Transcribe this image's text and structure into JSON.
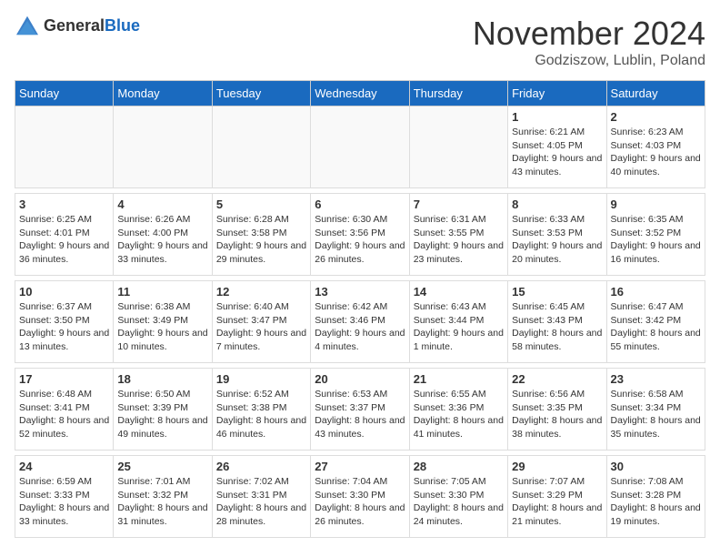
{
  "header": {
    "logo_general": "General",
    "logo_blue": "Blue",
    "month_title": "November 2024",
    "location": "Godziszow, Lublin, Poland"
  },
  "days_of_week": [
    "Sunday",
    "Monday",
    "Tuesday",
    "Wednesday",
    "Thursday",
    "Friday",
    "Saturday"
  ],
  "weeks": [
    {
      "days": [
        {
          "num": "",
          "info": ""
        },
        {
          "num": "",
          "info": ""
        },
        {
          "num": "",
          "info": ""
        },
        {
          "num": "",
          "info": ""
        },
        {
          "num": "",
          "info": ""
        },
        {
          "num": "1",
          "info": "Sunrise: 6:21 AM\nSunset: 4:05 PM\nDaylight: 9 hours\nand 43 minutes."
        },
        {
          "num": "2",
          "info": "Sunrise: 6:23 AM\nSunset: 4:03 PM\nDaylight: 9 hours\nand 40 minutes."
        }
      ]
    },
    {
      "days": [
        {
          "num": "3",
          "info": "Sunrise: 6:25 AM\nSunset: 4:01 PM\nDaylight: 9 hours\nand 36 minutes."
        },
        {
          "num": "4",
          "info": "Sunrise: 6:26 AM\nSunset: 4:00 PM\nDaylight: 9 hours\nand 33 minutes."
        },
        {
          "num": "5",
          "info": "Sunrise: 6:28 AM\nSunset: 3:58 PM\nDaylight: 9 hours\nand 29 minutes."
        },
        {
          "num": "6",
          "info": "Sunrise: 6:30 AM\nSunset: 3:56 PM\nDaylight: 9 hours\nand 26 minutes."
        },
        {
          "num": "7",
          "info": "Sunrise: 6:31 AM\nSunset: 3:55 PM\nDaylight: 9 hours\nand 23 minutes."
        },
        {
          "num": "8",
          "info": "Sunrise: 6:33 AM\nSunset: 3:53 PM\nDaylight: 9 hours\nand 20 minutes."
        },
        {
          "num": "9",
          "info": "Sunrise: 6:35 AM\nSunset: 3:52 PM\nDaylight: 9 hours\nand 16 minutes."
        }
      ]
    },
    {
      "days": [
        {
          "num": "10",
          "info": "Sunrise: 6:37 AM\nSunset: 3:50 PM\nDaylight: 9 hours\nand 13 minutes."
        },
        {
          "num": "11",
          "info": "Sunrise: 6:38 AM\nSunset: 3:49 PM\nDaylight: 9 hours\nand 10 minutes."
        },
        {
          "num": "12",
          "info": "Sunrise: 6:40 AM\nSunset: 3:47 PM\nDaylight: 9 hours\nand 7 minutes."
        },
        {
          "num": "13",
          "info": "Sunrise: 6:42 AM\nSunset: 3:46 PM\nDaylight: 9 hours\nand 4 minutes."
        },
        {
          "num": "14",
          "info": "Sunrise: 6:43 AM\nSunset: 3:44 PM\nDaylight: 9 hours\nand 1 minute."
        },
        {
          "num": "15",
          "info": "Sunrise: 6:45 AM\nSunset: 3:43 PM\nDaylight: 8 hours\nand 58 minutes."
        },
        {
          "num": "16",
          "info": "Sunrise: 6:47 AM\nSunset: 3:42 PM\nDaylight: 8 hours\nand 55 minutes."
        }
      ]
    },
    {
      "days": [
        {
          "num": "17",
          "info": "Sunrise: 6:48 AM\nSunset: 3:41 PM\nDaylight: 8 hours\nand 52 minutes."
        },
        {
          "num": "18",
          "info": "Sunrise: 6:50 AM\nSunset: 3:39 PM\nDaylight: 8 hours\nand 49 minutes."
        },
        {
          "num": "19",
          "info": "Sunrise: 6:52 AM\nSunset: 3:38 PM\nDaylight: 8 hours\nand 46 minutes."
        },
        {
          "num": "20",
          "info": "Sunrise: 6:53 AM\nSunset: 3:37 PM\nDaylight: 8 hours\nand 43 minutes."
        },
        {
          "num": "21",
          "info": "Sunrise: 6:55 AM\nSunset: 3:36 PM\nDaylight: 8 hours\nand 41 minutes."
        },
        {
          "num": "22",
          "info": "Sunrise: 6:56 AM\nSunset: 3:35 PM\nDaylight: 8 hours\nand 38 minutes."
        },
        {
          "num": "23",
          "info": "Sunrise: 6:58 AM\nSunset: 3:34 PM\nDaylight: 8 hours\nand 35 minutes."
        }
      ]
    },
    {
      "days": [
        {
          "num": "24",
          "info": "Sunrise: 6:59 AM\nSunset: 3:33 PM\nDaylight: 8 hours\nand 33 minutes."
        },
        {
          "num": "25",
          "info": "Sunrise: 7:01 AM\nSunset: 3:32 PM\nDaylight: 8 hours\nand 31 minutes."
        },
        {
          "num": "26",
          "info": "Sunrise: 7:02 AM\nSunset: 3:31 PM\nDaylight: 8 hours\nand 28 minutes."
        },
        {
          "num": "27",
          "info": "Sunrise: 7:04 AM\nSunset: 3:30 PM\nDaylight: 8 hours\nand 26 minutes."
        },
        {
          "num": "28",
          "info": "Sunrise: 7:05 AM\nSunset: 3:30 PM\nDaylight: 8 hours\nand 24 minutes."
        },
        {
          "num": "29",
          "info": "Sunrise: 7:07 AM\nSunset: 3:29 PM\nDaylight: 8 hours\nand 21 minutes."
        },
        {
          "num": "30",
          "info": "Sunrise: 7:08 AM\nSunset: 3:28 PM\nDaylight: 8 hours\nand 19 minutes."
        }
      ]
    }
  ]
}
